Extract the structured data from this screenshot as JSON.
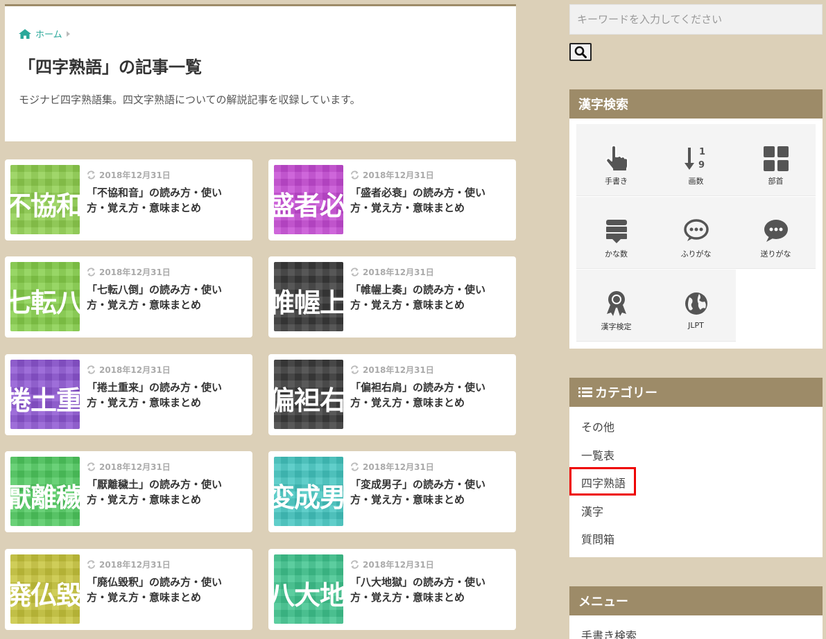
{
  "breadcrumb": {
    "home_label": "ホーム"
  },
  "page": {
    "title": "「四字熟語」の記事一覧",
    "description": "モジナビ四字熟語集。四文字熟語についての解説記事を収録しています。"
  },
  "cards": [
    {
      "thumb_text": "不協和音",
      "date": "2018年12月31日",
      "title": "「不協和音」の読み方・使い方・覚え方・意味まとめ",
      "color": "#8fcf4f"
    },
    {
      "thumb_text": "盛者必衰",
      "date": "2018年12月31日",
      "title": "「盛者必衰」の読み方・使い方・覚え方・意味まとめ",
      "color": "#c54bd4"
    },
    {
      "thumb_text": "七転八倒",
      "date": "2018年12月31日",
      "title": "「七転八倒」の読み方・使い方・覚え方・意味まとめ",
      "color": "#86cf4b"
    },
    {
      "thumb_text": "帷幄上奏",
      "date": "2018年12月31日",
      "title": "「帷幄上奏」の読み方・使い方・覚え方・意味まとめ",
      "color": "#3a3a3a"
    },
    {
      "thumb_text": "捲土重来",
      "date": "2018年12月31日",
      "title": "「捲土重来」の読み方・使い方・覚え方・意味まとめ",
      "color": "#8d55d2"
    },
    {
      "thumb_text": "偏袒右肩",
      "date": "2018年12月31日",
      "title": "「偏袒右肩」の読み方・使い方・覚え方・意味まとめ",
      "color": "#3c3c3c"
    },
    {
      "thumb_text": "厭離穢土",
      "date": "2018年12月31日",
      "title": "「厭離穢土」の読み方・使い方・覚え方・意味まとめ",
      "color": "#4fc95f"
    },
    {
      "thumb_text": "変成男子",
      "date": "2018年12月31日",
      "title": "「変成男子」の読み方・使い方・覚え方・意味まとめ",
      "color": "#43c6c0"
    },
    {
      "thumb_text": "廃仏毀釈",
      "date": "2018年12月31日",
      "title": "「廃仏毀釈」の読み方・使い方・覚え方・意味まとめ",
      "color": "#c7c43c"
    },
    {
      "thumb_text": "八大地獄",
      "date": "2018年12月31日",
      "title": "「八大地獄」の読み方・使い方・覚え方・意味まとめ",
      "color": "#3fc48e"
    }
  ],
  "sidebar": {
    "search_placeholder": "キーワードを入力してください",
    "kanji_search": {
      "heading": "漢字検索",
      "items": [
        {
          "label": "手書き",
          "icon": "hand-pointer-icon"
        },
        {
          "label": "画数",
          "icon": "sort-numeric-icon"
        },
        {
          "label": "部首",
          "icon": "grid-icon"
        },
        {
          "label": "かな数",
          "icon": "list-icon"
        },
        {
          "label": "ふりがな",
          "icon": "speech-bubble-outline-icon"
        },
        {
          "label": "送りがな",
          "icon": "speech-bubble-icon"
        },
        {
          "label": "漢字検定",
          "icon": "award-icon"
        },
        {
          "label": "JLPT",
          "icon": "globe-icon"
        }
      ]
    },
    "categories": {
      "heading": "カテゴリー",
      "items": [
        "その他",
        "一覧表",
        "四字熟語",
        "漢字",
        "質問箱"
      ]
    },
    "menu": {
      "heading": "メニュー",
      "first_item": "手書き検索"
    }
  }
}
